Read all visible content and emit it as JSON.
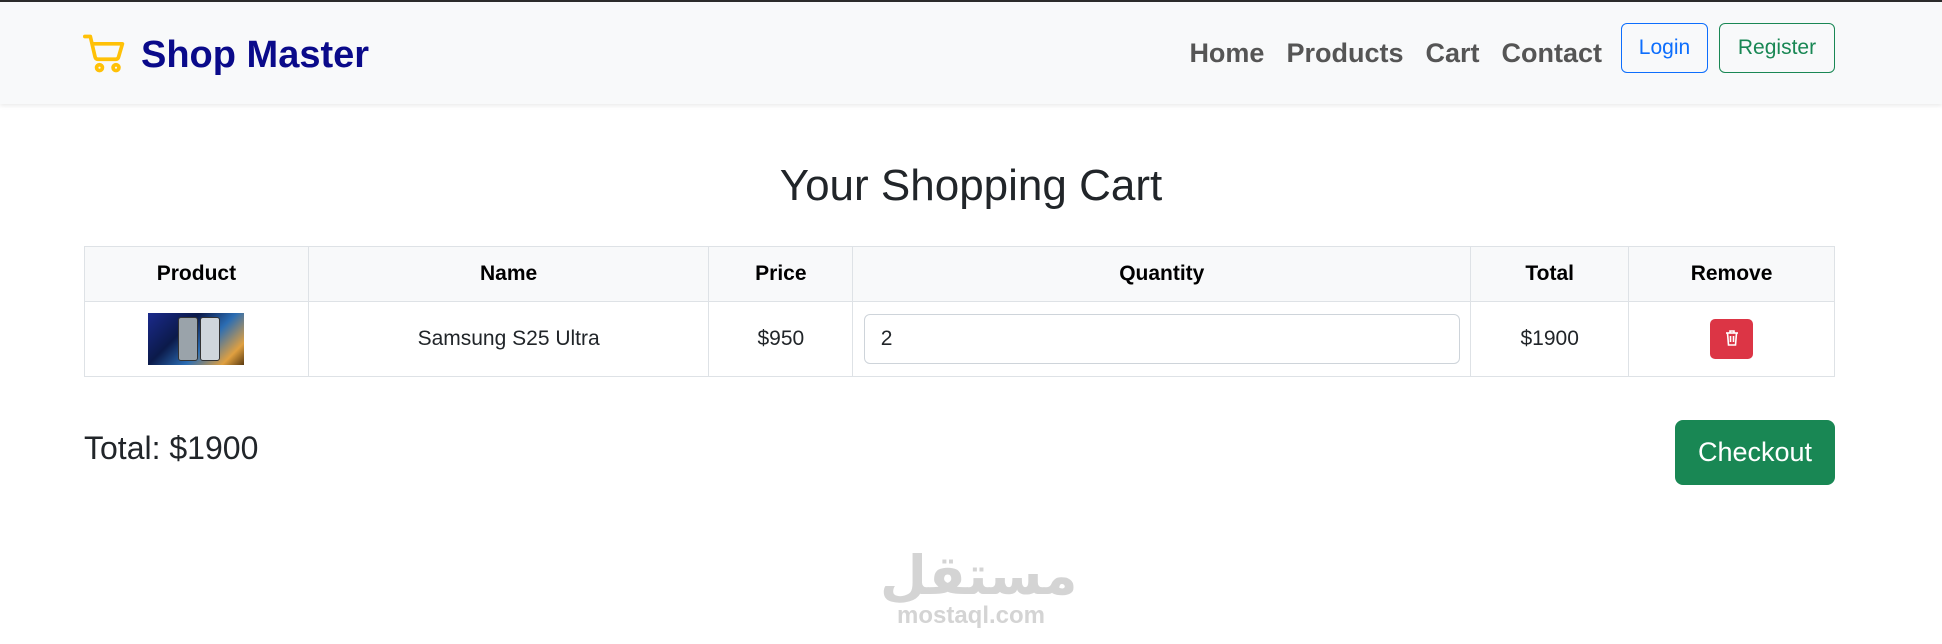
{
  "brand": {
    "name": "Shop Master",
    "icon": "cart-icon",
    "icon_color": "#ffc107",
    "text_color": "#0a0a8a"
  },
  "nav": {
    "links": [
      "Home",
      "Products",
      "Cart",
      "Contact"
    ],
    "login_label": "Login",
    "register_label": "Register"
  },
  "page": {
    "title": "Your Shopping Cart"
  },
  "cart_table": {
    "headers": [
      "Product",
      "Name",
      "Price",
      "Quantity",
      "Total",
      "Remove"
    ],
    "rows": [
      {
        "product_image": "samsung-s25-ultra-image",
        "name": "Samsung S25 Ultra",
        "price": "$950",
        "quantity": "2",
        "total": "$1900",
        "remove_icon": "trash-icon"
      }
    ]
  },
  "summary": {
    "total_label": "Total: $1900",
    "checkout_label": "Checkout"
  },
  "watermark": {
    "arabic": "مستقل",
    "latin": "mostaql.com"
  },
  "colors": {
    "primary": "#0d6efd",
    "success": "#198754",
    "danger": "#dc3545",
    "navbar_bg": "#f8f9fa"
  }
}
